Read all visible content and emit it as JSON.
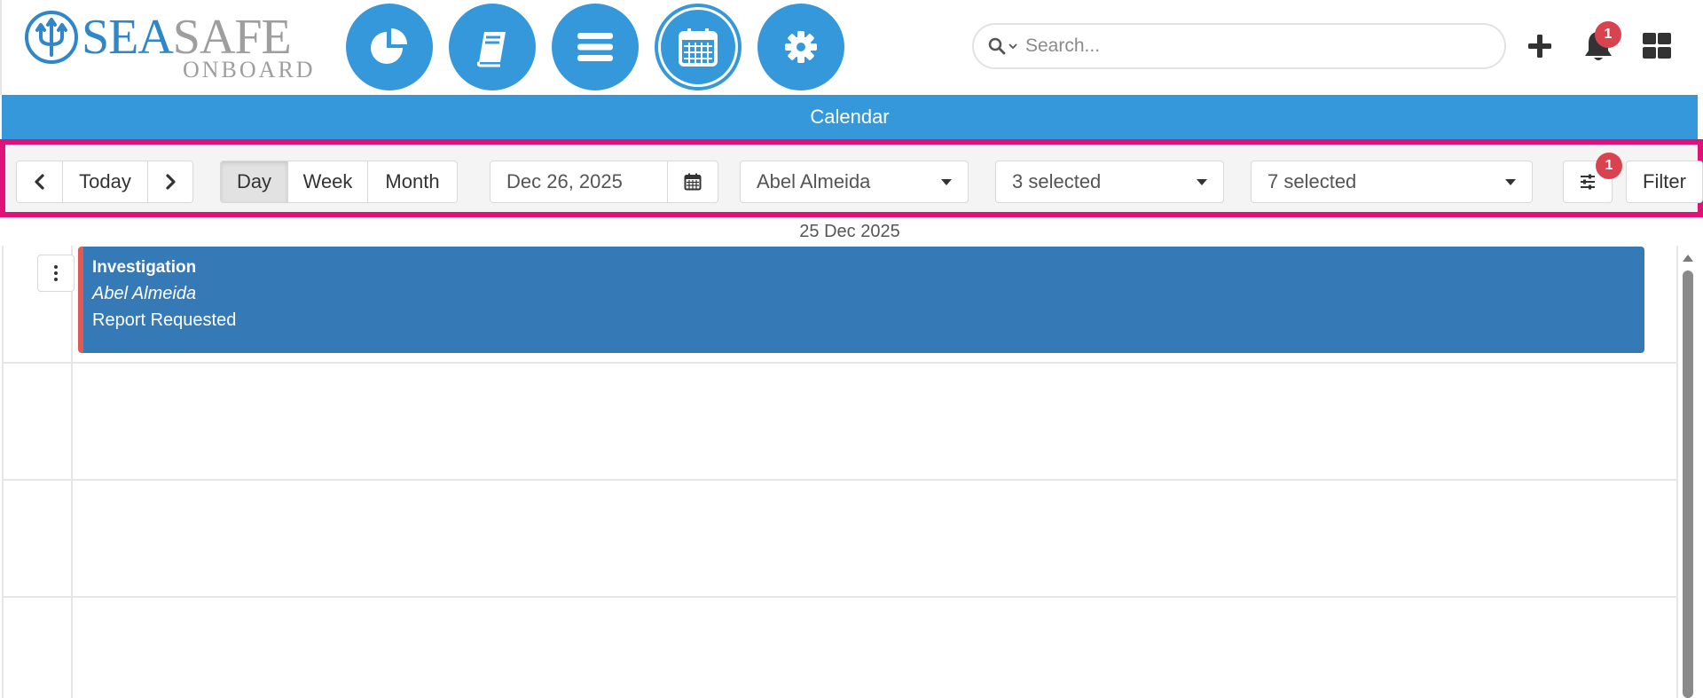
{
  "header": {
    "logo": {
      "word_main_a": "SEA",
      "word_main_b": "SAFE",
      "word_sub": "ONBOARD"
    },
    "nav": [
      {
        "name": "dashboard",
        "icon": "pie-chart-icon"
      },
      {
        "name": "logbook",
        "icon": "book-icon"
      },
      {
        "name": "menu",
        "icon": "list-icon"
      },
      {
        "name": "calendar",
        "icon": "calendar-icon",
        "active": true
      },
      {
        "name": "settings",
        "icon": "gear-icon"
      }
    ],
    "search": {
      "placeholder": "Search..."
    },
    "notifications_count": "1"
  },
  "calendar_bar": {
    "title": "Calendar"
  },
  "toolbar": {
    "today_label": "Today",
    "views": {
      "day": "Day",
      "week": "Week",
      "month": "Month"
    },
    "active_view": "Day",
    "date_value": "Dec 26, 2025",
    "person_select": "Abel Almeida",
    "select_2": "3 selected",
    "select_3": "7 selected",
    "filter_badge": "1",
    "filter_label": "Filter"
  },
  "day_view": {
    "header_date": "25 Dec 2025",
    "events": [
      {
        "title": "Investigation",
        "person": "Abel Almeida",
        "status": "Report Requested"
      }
    ]
  },
  "colors": {
    "primary": "#3498db",
    "event_bg": "#357ab7",
    "event_accent": "#e05a55",
    "badge": "#d9434f",
    "highlight_border": "#e0127a",
    "logo_blue": "#2f86c8",
    "logo_gray": "#9e9e9e"
  }
}
